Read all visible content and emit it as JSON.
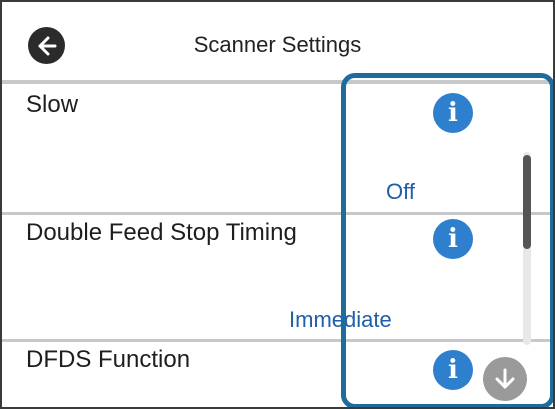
{
  "header": {
    "title": "Scanner Settings",
    "back_icon": "arrow-left-icon"
  },
  "settings": [
    {
      "label": "Slow",
      "value": "Off",
      "info_icon": "info-icon"
    },
    {
      "label": "Double Feed Stop Timing",
      "value": "Immediate",
      "info_icon": "info-icon"
    },
    {
      "label": "DFDS Function",
      "value": "",
      "info_icon": "info-icon"
    }
  ],
  "info_glyph": "i",
  "scroll": {
    "down_icon": "arrow-down-icon"
  },
  "colors": {
    "value_text": "#1f5fa8",
    "info_icon": "#2e7fce",
    "highlight_border": "#1d6c9c",
    "back_button": "#2b2b2b"
  }
}
